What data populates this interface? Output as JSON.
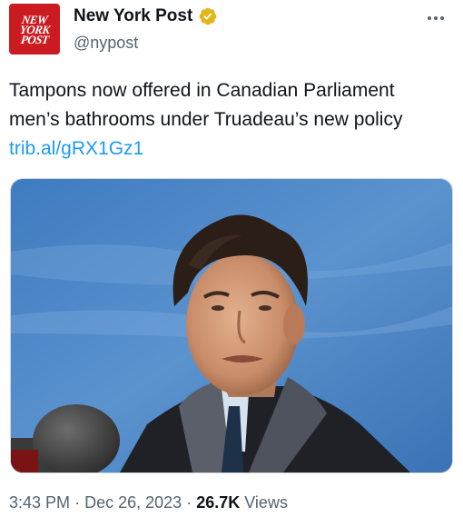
{
  "account": {
    "name": "New York Post",
    "handle": "@nypost",
    "avatar_text": [
      "NEW",
      "YORK",
      "POST"
    ],
    "avatar_color": "#cc1b20",
    "verified_badge_color": "#e2b719"
  },
  "tweet": {
    "text_line1": "Tampons now offered in Canadian Parliament",
    "text_line2": "men’s bathrooms under Truadeau’s new policy",
    "link": "trib.al/gRX1Gz1"
  },
  "meta": {
    "time": "3:43 PM",
    "separator": "·",
    "date": "Dec 26, 2023",
    "views_count": "26.7K",
    "views_label": "Views"
  },
  "icons": {
    "more": "more-horizontal-icon",
    "verified": "verified-badge-icon"
  },
  "colors": {
    "link": "#1d9bf0",
    "secondary_text": "#536471",
    "sky": "#4d86c6"
  }
}
